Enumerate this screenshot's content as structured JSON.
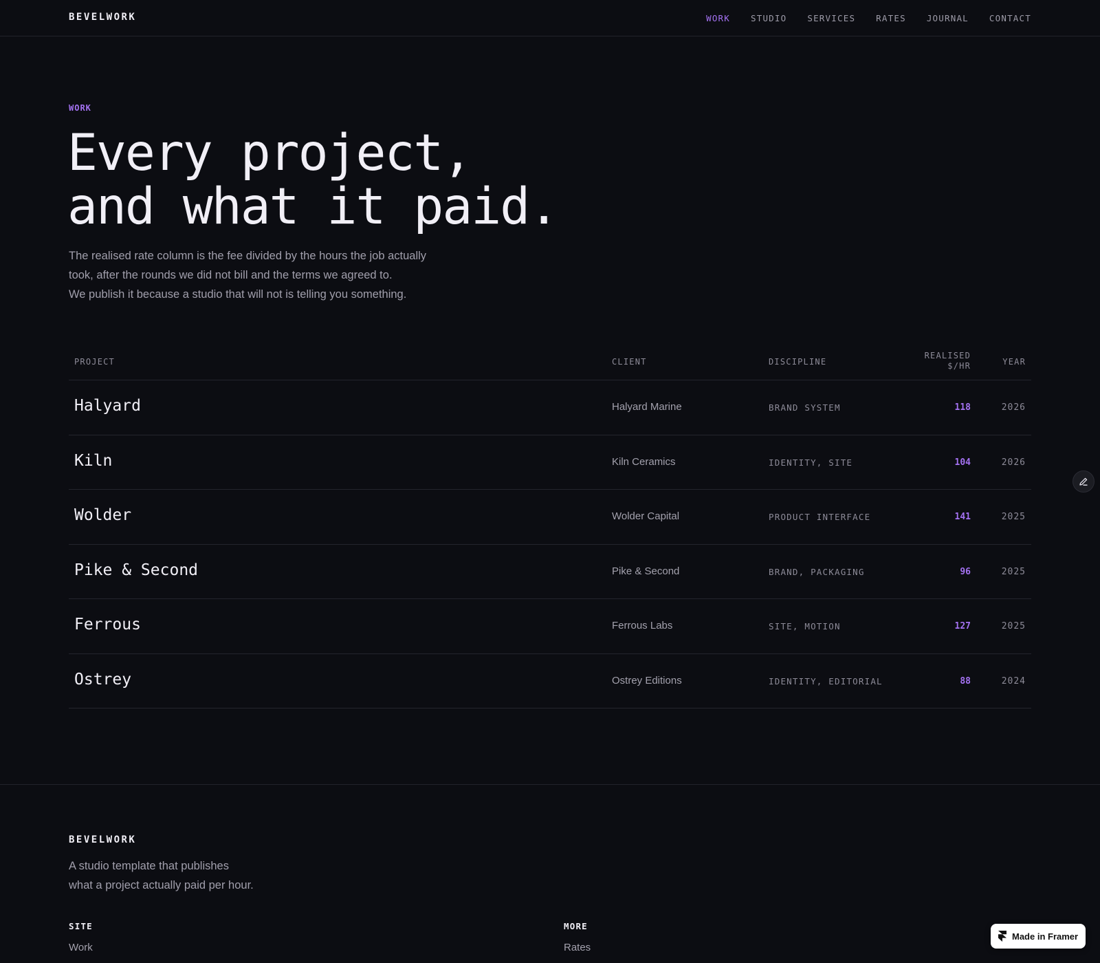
{
  "header": {
    "brand": "BEVELWORK",
    "nav": [
      {
        "label": "WORK",
        "active": true
      },
      {
        "label": "STUDIO",
        "active": false
      },
      {
        "label": "SERVICES",
        "active": false
      },
      {
        "label": "RATES",
        "active": false
      },
      {
        "label": "JOURNAL",
        "active": false
      },
      {
        "label": "CONTACT",
        "active": false
      }
    ]
  },
  "hero": {
    "eyebrow": "WORK",
    "headline_line1": "Every project,",
    "headline_line2": "and what it paid.",
    "lede_line1": "The realised rate column is the fee divided by the hours the job actually",
    "lede_line2": "took, after the rounds we did not bill and the terms we agreed to.",
    "lede_line3": "We publish it because a studio that will not is telling you something."
  },
  "table": {
    "headers": {
      "project": "PROJECT",
      "client": "CLIENT",
      "discipline": "DISCIPLINE",
      "rate_line1": "REALISED",
      "rate_line2": "$/HR",
      "year": "YEAR"
    },
    "rows": [
      {
        "project": "Halyard",
        "client": "Halyard Marine",
        "discipline": "BRAND SYSTEM",
        "rate": "118",
        "year": "2026"
      },
      {
        "project": "Kiln",
        "client": "Kiln Ceramics",
        "discipline": "IDENTITY, SITE",
        "rate": "104",
        "year": "2026"
      },
      {
        "project": "Wolder",
        "client": "Wolder Capital",
        "discipline": "PRODUCT INTERFACE",
        "rate": "141",
        "year": "2025"
      },
      {
        "project": "Pike & Second",
        "client": "Pike & Second",
        "discipline": "BRAND, PACKAGING",
        "rate": "96",
        "year": "2025"
      },
      {
        "project": "Ferrous",
        "client": "Ferrous Labs",
        "discipline": "SITE, MOTION",
        "rate": "127",
        "year": "2025"
      },
      {
        "project": "Ostrey",
        "client": "Ostrey Editions",
        "discipline": "IDENTITY, EDITORIAL",
        "rate": "88",
        "year": "2024"
      }
    ]
  },
  "footer": {
    "brand": "BEVELWORK",
    "tagline_line1": "A studio template that publishes",
    "tagline_line2": "what a project actually paid per hour.",
    "site_heading": "SITE",
    "site_links": [
      "Work"
    ],
    "more_heading": "MORE",
    "more_links": [
      "Rates"
    ]
  },
  "badge": {
    "label": "Made in Framer",
    "icon": "framer-logo-icon"
  },
  "edit_button": {
    "icon": "pencil-icon"
  },
  "colors": {
    "background": "#0c0d12",
    "accent": "#a472f2",
    "text": "#f1eff6",
    "muted": "#a19fac"
  }
}
